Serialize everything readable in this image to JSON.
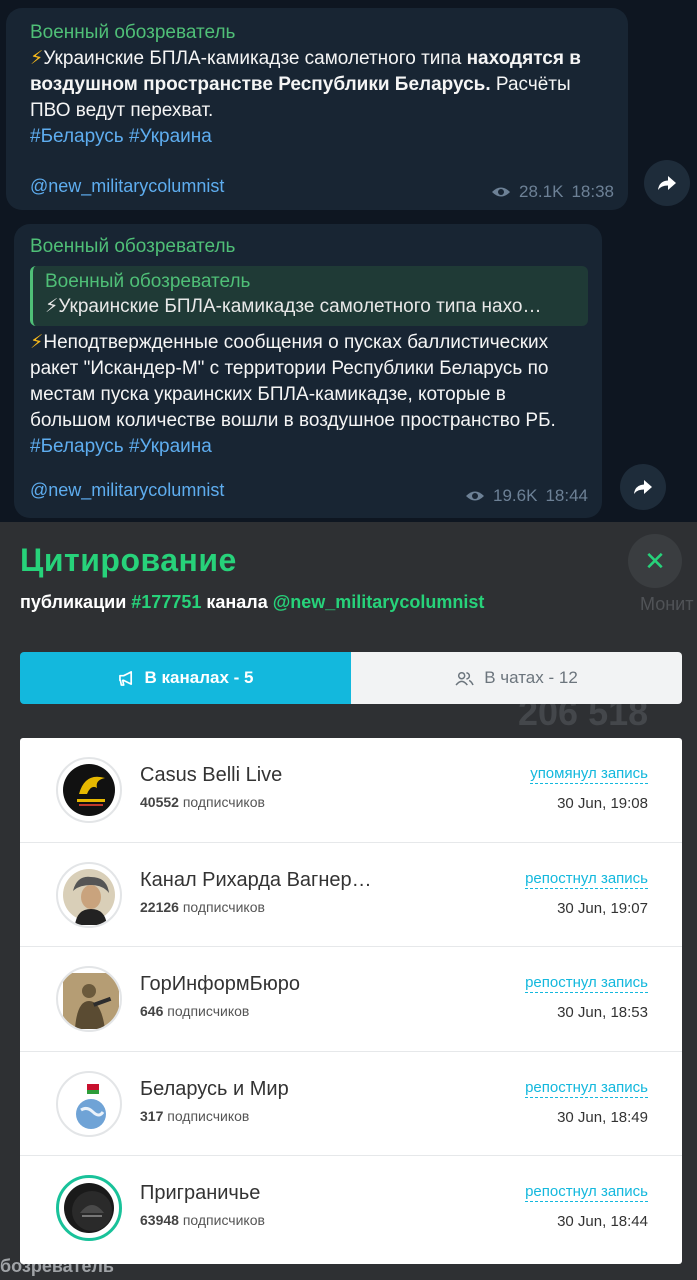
{
  "messages": [
    {
      "author": "Военный обозреватель",
      "bolt": "⚡",
      "text_normal": "Украинские БПЛА-камикадзе самолетного типа ",
      "text_bold": "находятся в воздушном пространстве Республики Беларусь.",
      "text_tail": " Расчёты ПВО ведут перехват.",
      "tags": "#Беларусь #Украина",
      "signature": "@new_militarycolumnist",
      "views": "28.1K",
      "time": "18:38"
    },
    {
      "author": "Военный обозреватель",
      "quote_author": "Военный обозреватель",
      "quote_text": "⚡Украинские БПЛА-камикадзе самолетного типа нахо…",
      "bolt": "⚡",
      "text": "Неподтвержденные сообщения о пусках баллистических ракет \"Искандер-М\" с территории Республики Беларусь по местам пуска украинских БПЛА-камикадзе, которые в большом количестве вошли в воздушное пространство РБ.",
      "tags": "#Беларусь #Украина",
      "signature": "@new_militarycolumnist",
      "views": "19.6K",
      "time": "18:44"
    }
  ],
  "panel": {
    "title": "Цитирование",
    "sub_prefix": "публикации ",
    "post_id": "#177751",
    "sub_mid": " канала ",
    "channel": "@new_militarycolumnist",
    "bg_number": "206 518",
    "bg_monitor": "Монит",
    "bg_footer": "бозреватель",
    "close_icon": "✕",
    "tabs": [
      {
        "label": "В каналах - 5",
        "icon": "megaphone-icon"
      },
      {
        "label": "В чатах - 12",
        "icon": "users-icon"
      }
    ],
    "subs_word": "подписчиков",
    "rows": [
      {
        "name": "Casus Belli Live",
        "subs": "40552",
        "action": "упомянул запись",
        "time": "30 Jun, 19:08"
      },
      {
        "name": "Канал Рихарда Вагнер…",
        "subs": "22126",
        "action": "репостнул запись",
        "time": "30 Jun, 19:07"
      },
      {
        "name": "ГорИнформБюро",
        "subs": "646",
        "action": "репостнул запись",
        "time": "30 Jun, 18:53"
      },
      {
        "name": "Беларусь и Мир",
        "subs": "317",
        "action": "репостнул запись",
        "time": "30 Jun, 18:49"
      },
      {
        "name": "Приграничье",
        "subs": "63948",
        "action": "репостнул запись",
        "time": "30 Jun, 18:44"
      }
    ]
  },
  "colors": {
    "tg_bg": "#0e1621",
    "bubble": "#182533",
    "accent_green": "#27d27a",
    "tab_active": "#13b8dd"
  }
}
